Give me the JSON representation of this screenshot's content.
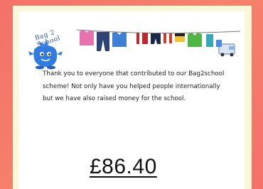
{
  "logo": {
    "text": "Bag 2 School",
    "mascot": "blue-bag-mascot-icon"
  },
  "illustration": {
    "name": "washing-line-clothes-icon"
  },
  "message": "Thank you to everyone that contributed to our Bag2school scheme! Not only have you helped people internationally but we have also raised money for the school.",
  "amount": "£86.40",
  "colors": {
    "background": "#f4716a",
    "frame": "#faf6d8",
    "card": "#ffffff",
    "logo_blue": "#2f7be0"
  }
}
